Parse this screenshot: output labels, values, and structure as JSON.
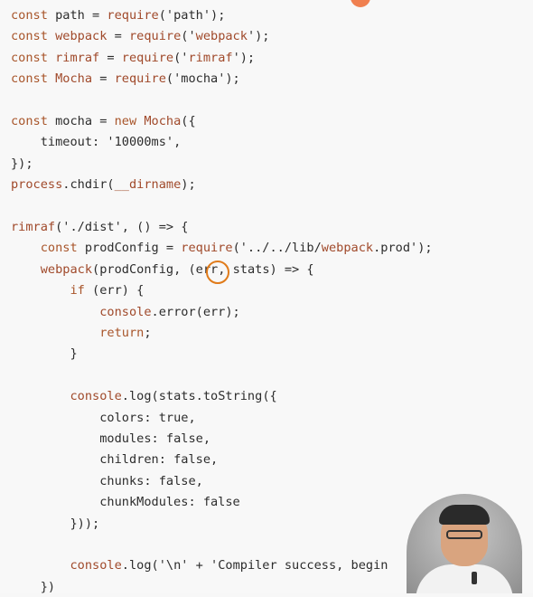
{
  "code_lines": [
    {
      "text": "const path = require('path');"
    },
    {
      "text": "const webpack = require('webpack');"
    },
    {
      "text": "const rimraf = require('rimraf');"
    },
    {
      "text": "const Mocha = require('mocha');"
    },
    {
      "text": ""
    },
    {
      "text": "const mocha = new Mocha({"
    },
    {
      "text": "    timeout: '10000ms',"
    },
    {
      "text": "});"
    },
    {
      "text": "process.chdir(__dirname);"
    },
    {
      "text": ""
    },
    {
      "text": "rimraf('./dist', () => {"
    },
    {
      "text": "    const prodConfig = require('../../lib/webpack.prod');"
    },
    {
      "text": "    webpack(prodConfig, (err, stats) => {"
    },
    {
      "text": "        if (err) {"
    },
    {
      "text": "            console.error(err);"
    },
    {
      "text": "            return;"
    },
    {
      "text": "        }"
    },
    {
      "text": ""
    },
    {
      "text": "        console.log(stats.toString({"
    },
    {
      "text": "            colors: true,"
    },
    {
      "text": "            modules: false,"
    },
    {
      "text": "            children: false,"
    },
    {
      "text": "            chunks: false,"
    },
    {
      "text": "            chunkModules: false"
    },
    {
      "text": "        }));"
    },
    {
      "text": ""
    },
    {
      "text": "        console.log('\\n' + 'Compiler success, begin"
    },
    {
      "text": "    })"
    }
  ],
  "colors": {
    "background": "#f8f8f8",
    "keyword": "#a8552a",
    "text": "#2c2c2c",
    "cursor_circle": "#e07b1a"
  }
}
